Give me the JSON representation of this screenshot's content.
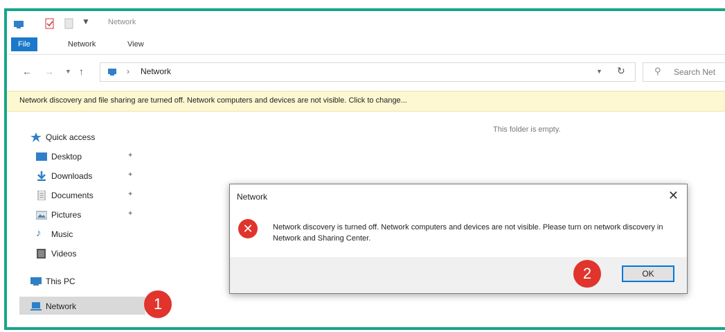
{
  "window": {
    "title": "Network"
  },
  "ribbon": {
    "tabs": [
      "File",
      "Network",
      "View"
    ]
  },
  "address": {
    "path": "Network",
    "search_placeholder": "Search Net"
  },
  "infobar": {
    "message": "Network discovery and file sharing are turned off. Network computers and devices are not visible. Click to change..."
  },
  "sidebar": {
    "items": [
      {
        "label": "Quick access",
        "icon": "star-icon"
      },
      {
        "label": "Desktop",
        "icon": "desktop-icon",
        "pinned": true
      },
      {
        "label": "Downloads",
        "icon": "download-icon",
        "pinned": true
      },
      {
        "label": "Documents",
        "icon": "documents-icon",
        "pinned": true
      },
      {
        "label": "Pictures",
        "icon": "pictures-icon",
        "pinned": true
      },
      {
        "label": "Music",
        "icon": "music-icon"
      },
      {
        "label": "Videos",
        "icon": "videos-icon"
      },
      {
        "label": "This PC",
        "icon": "computer-icon"
      },
      {
        "label": "Network",
        "icon": "network-icon",
        "selected": true
      }
    ]
  },
  "content": {
    "empty_text": "This folder is empty."
  },
  "dialog": {
    "title": "Network",
    "message": "Network discovery is turned off. Network computers and devices are not visible. Please turn on network discovery in Network and Sharing Center.",
    "ok_label": "OK"
  },
  "markers": [
    "1",
    "2"
  ],
  "colors": {
    "frame": "#17a589",
    "file_tab": "#1979ca",
    "marker": "#e0342c",
    "infobar": "#fdf8d2"
  }
}
